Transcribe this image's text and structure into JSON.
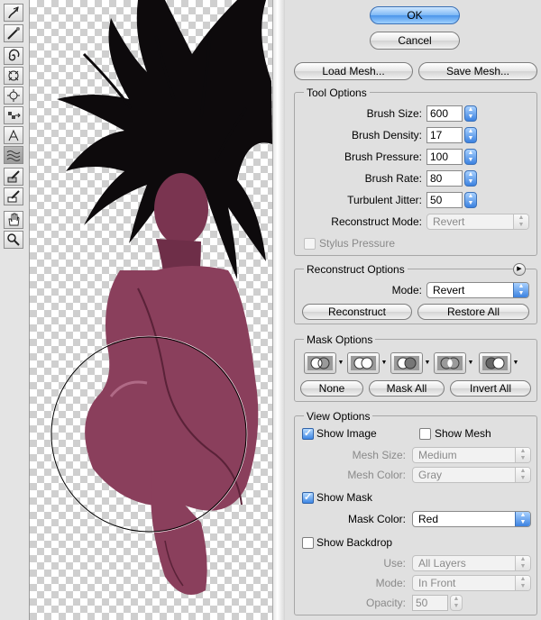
{
  "tools": [
    {
      "icon": "forward-warp-icon"
    },
    {
      "icon": "reconstruct-icon"
    },
    {
      "icon": "twirl-icon"
    },
    {
      "icon": "pucker-icon"
    },
    {
      "icon": "bloat-icon"
    },
    {
      "icon": "push-left-icon"
    },
    {
      "icon": "mirror-icon"
    },
    {
      "icon": "turbulence-icon"
    },
    {
      "icon": "freeze-mask-icon"
    },
    {
      "icon": "thaw-mask-icon"
    },
    {
      "icon": "hand-icon"
    },
    {
      "icon": "zoom-icon"
    }
  ],
  "dialog": {
    "ok_label": "OK",
    "cancel_label": "Cancel"
  },
  "mesh": {
    "load_label": "Load Mesh...",
    "save_label": "Save Mesh..."
  },
  "tool_options": {
    "title": "Tool Options",
    "brush_size_label": "Brush Size:",
    "brush_size_value": "600",
    "brush_density_label": "Brush Density:",
    "brush_density_value": "17",
    "brush_pressure_label": "Brush Pressure:",
    "brush_pressure_value": "100",
    "brush_rate_label": "Brush Rate:",
    "brush_rate_value": "80",
    "turbulent_jitter_label": "Turbulent Jitter:",
    "turbulent_jitter_value": "50",
    "reconstruct_mode_label": "Reconstruct Mode:",
    "reconstruct_mode_value": "Revert",
    "stylus_pressure_label": "Stylus Pressure"
  },
  "reconstruct_options": {
    "title": "Reconstruct Options",
    "mode_label": "Mode:",
    "mode_value": "Revert",
    "reconstruct_label": "Reconstruct",
    "restore_all_label": "Restore All"
  },
  "mask_options": {
    "title": "Mask Options",
    "none_label": "None",
    "mask_all_label": "Mask All",
    "invert_all_label": "Invert All"
  },
  "view_options": {
    "title": "View Options",
    "show_image_label": "Show Image",
    "show_mesh_label": "Show Mesh",
    "mesh_size_label": "Mesh Size:",
    "mesh_size_value": "Medium",
    "mesh_color_label": "Mesh Color:",
    "mesh_color_value": "Gray",
    "show_mask_label": "Show Mask",
    "mask_color_label": "Mask Color:",
    "mask_color_value": "Red",
    "show_backdrop_label": "Show Backdrop",
    "use_label": "Use:",
    "use_value": "All Layers",
    "mode_label": "Mode:",
    "mode_value": "In Front",
    "opacity_label": "Opacity:",
    "opacity_value": "50"
  },
  "colors": {
    "accent": "#3b82e0",
    "skin": "#8a3f5c",
    "hair": "#0d0a0c"
  }
}
